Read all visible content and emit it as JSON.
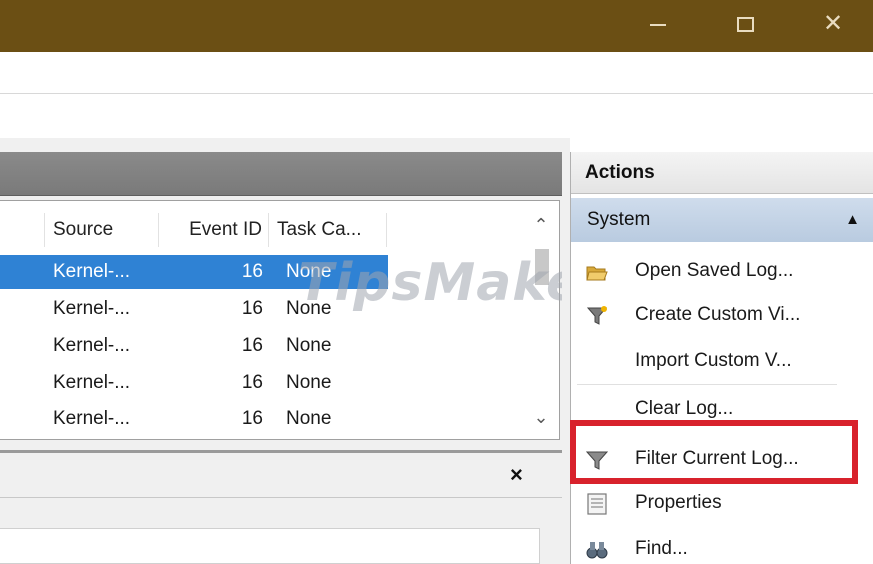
{
  "window": {
    "controls": {
      "minimize_icon": "minimize-icon",
      "maximize_icon": "maximize-icon",
      "close_icon": "close-icon"
    },
    "titlebar_color": "#6b4f14"
  },
  "grid": {
    "columns": [
      "Source",
      "Event ID",
      "Task Ca..."
    ],
    "rows": [
      {
        "source": "Kernel-...",
        "event_id": "16",
        "task": "None",
        "selected": true
      },
      {
        "source": "Kernel-...",
        "event_id": "16",
        "task": "None",
        "selected": false
      },
      {
        "source": "Kernel-...",
        "event_id": "16",
        "task": "None",
        "selected": false
      },
      {
        "source": "Kernel-...",
        "event_id": "16",
        "task": "None",
        "selected": false
      },
      {
        "source": "Kernel-...",
        "event_id": "16",
        "task": "None",
        "selected": false
      }
    ],
    "selection_color": "#2f82d4"
  },
  "watermark": {
    "text": "TipsMake"
  },
  "detail_pane": {
    "close_label": "×"
  },
  "actions": {
    "title": "Actions",
    "section": "System",
    "items": [
      {
        "label": "Open Saved Log...",
        "icon": "folder-open-icon"
      },
      {
        "label": "Create Custom Vi...",
        "icon": "funnel-create-icon"
      },
      {
        "label": "Import Custom V...",
        "icon": "none"
      },
      {
        "label": "Clear Log...",
        "icon": "none"
      },
      {
        "label": "Filter Current Log...",
        "icon": "filter-icon"
      },
      {
        "label": "Properties",
        "icon": "properties-icon"
      },
      {
        "label": "Find...",
        "icon": "binoculars-icon"
      }
    ],
    "highlight_color": "#d8222c"
  }
}
